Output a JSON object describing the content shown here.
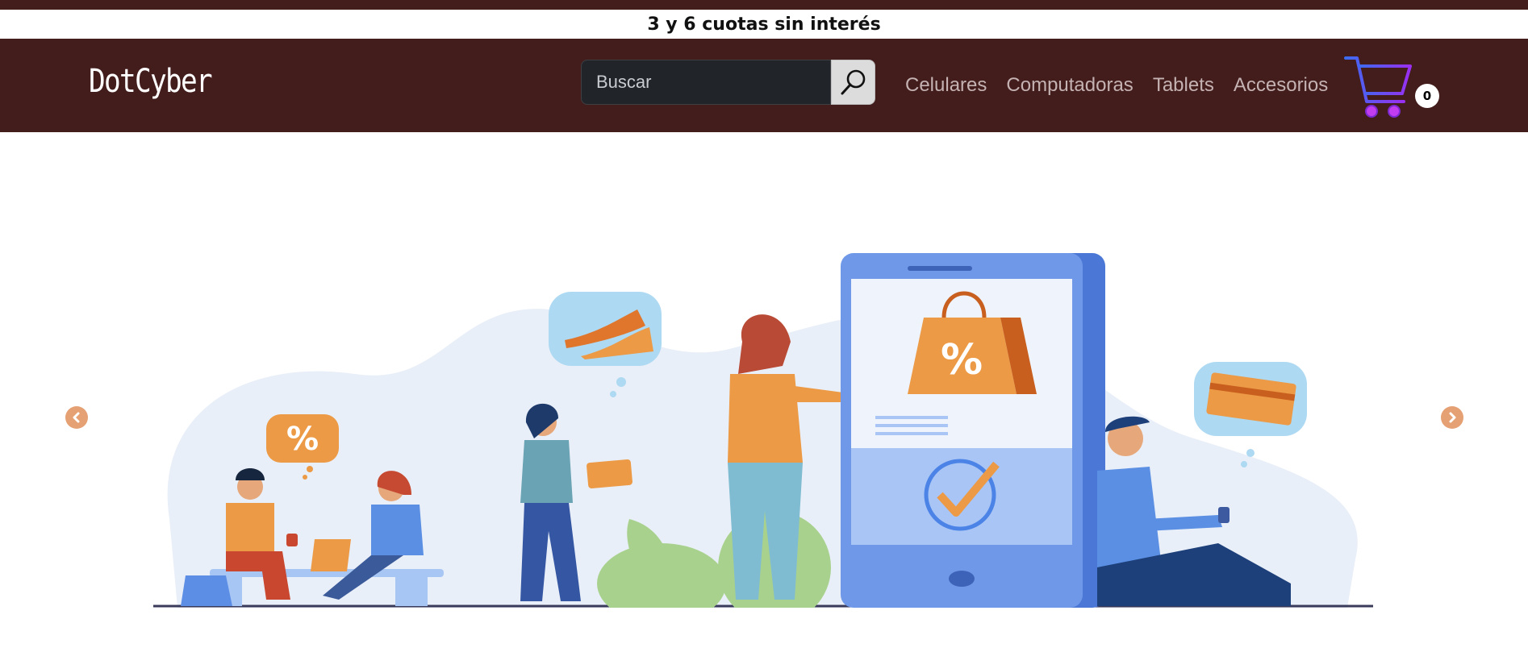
{
  "promo": {
    "text": "3 y 6 cuotas sin interés"
  },
  "navbar": {
    "brand": "DotCyber",
    "search": {
      "placeholder": "Buscar",
      "value": ""
    },
    "links": [
      {
        "label": "Celulares"
      },
      {
        "label": "Computadoras"
      },
      {
        "label": "Tablets"
      },
      {
        "label": "Accesorios"
      }
    ],
    "cart": {
      "count": "0",
      "icon": "shopping-cart-icon"
    }
  },
  "carousel": {
    "prev_icon": "chevron-left-icon",
    "next_icon": "chevron-right-icon",
    "illustration": {
      "badge_percent_small": "%",
      "bag_percent": "%"
    }
  },
  "colors": {
    "navbar_bg": "#431c1c",
    "accent_orange": "#ec9a45",
    "phone_blue": "#6f98e8",
    "arrow": "#e5a074"
  }
}
